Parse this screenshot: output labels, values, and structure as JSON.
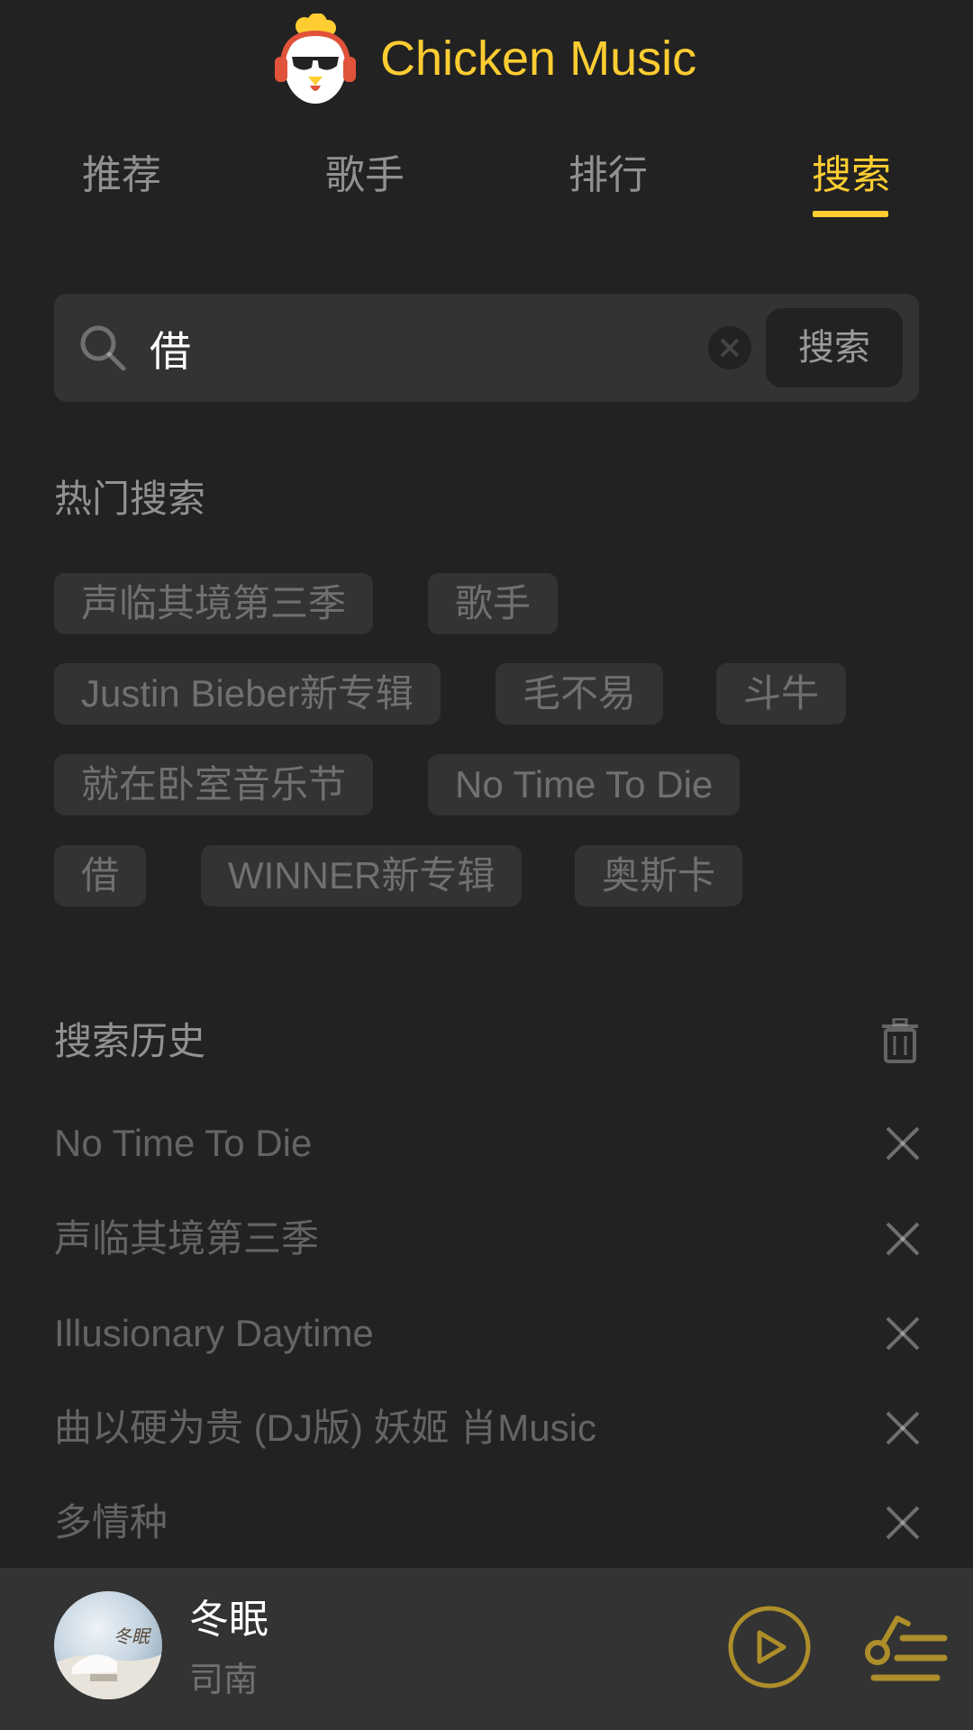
{
  "app": {
    "title": "Chicken Music",
    "accent_color": "#ffcd32",
    "background_color": "#222222",
    "logo_icon": "chicken-headphones-logo"
  },
  "tabs": [
    {
      "label": "推荐",
      "active": false
    },
    {
      "label": "歌手",
      "active": false
    },
    {
      "label": "排行",
      "active": false
    },
    {
      "label": "搜索",
      "active": true
    }
  ],
  "search": {
    "value": "借",
    "placeholder": "",
    "button_label": "搜索",
    "search_icon": "search-icon",
    "clear_icon": "clear-icon"
  },
  "hot_search": {
    "title": "热门搜索",
    "tags": [
      "声临其境第三季",
      "歌手",
      "Justin Bieber新专辑",
      "毛不易",
      "斗牛",
      "就在卧室音乐节",
      "No Time To Die",
      "借",
      "WINNER新专辑",
      "奥斯卡"
    ]
  },
  "history": {
    "title": "搜索历史",
    "clear_icon": "trash-icon",
    "items": [
      "No Time To Die",
      "声临其境第三季",
      "Illusionary Daytime",
      "曲以硬为贵 (DJ版) 妖姬 肖Music",
      "多情种"
    ]
  },
  "player": {
    "song_title": "冬眠",
    "artist": "司南",
    "cover_text": "冬眠",
    "play_icon": "play-icon",
    "playlist_icon": "playlist-icon"
  }
}
